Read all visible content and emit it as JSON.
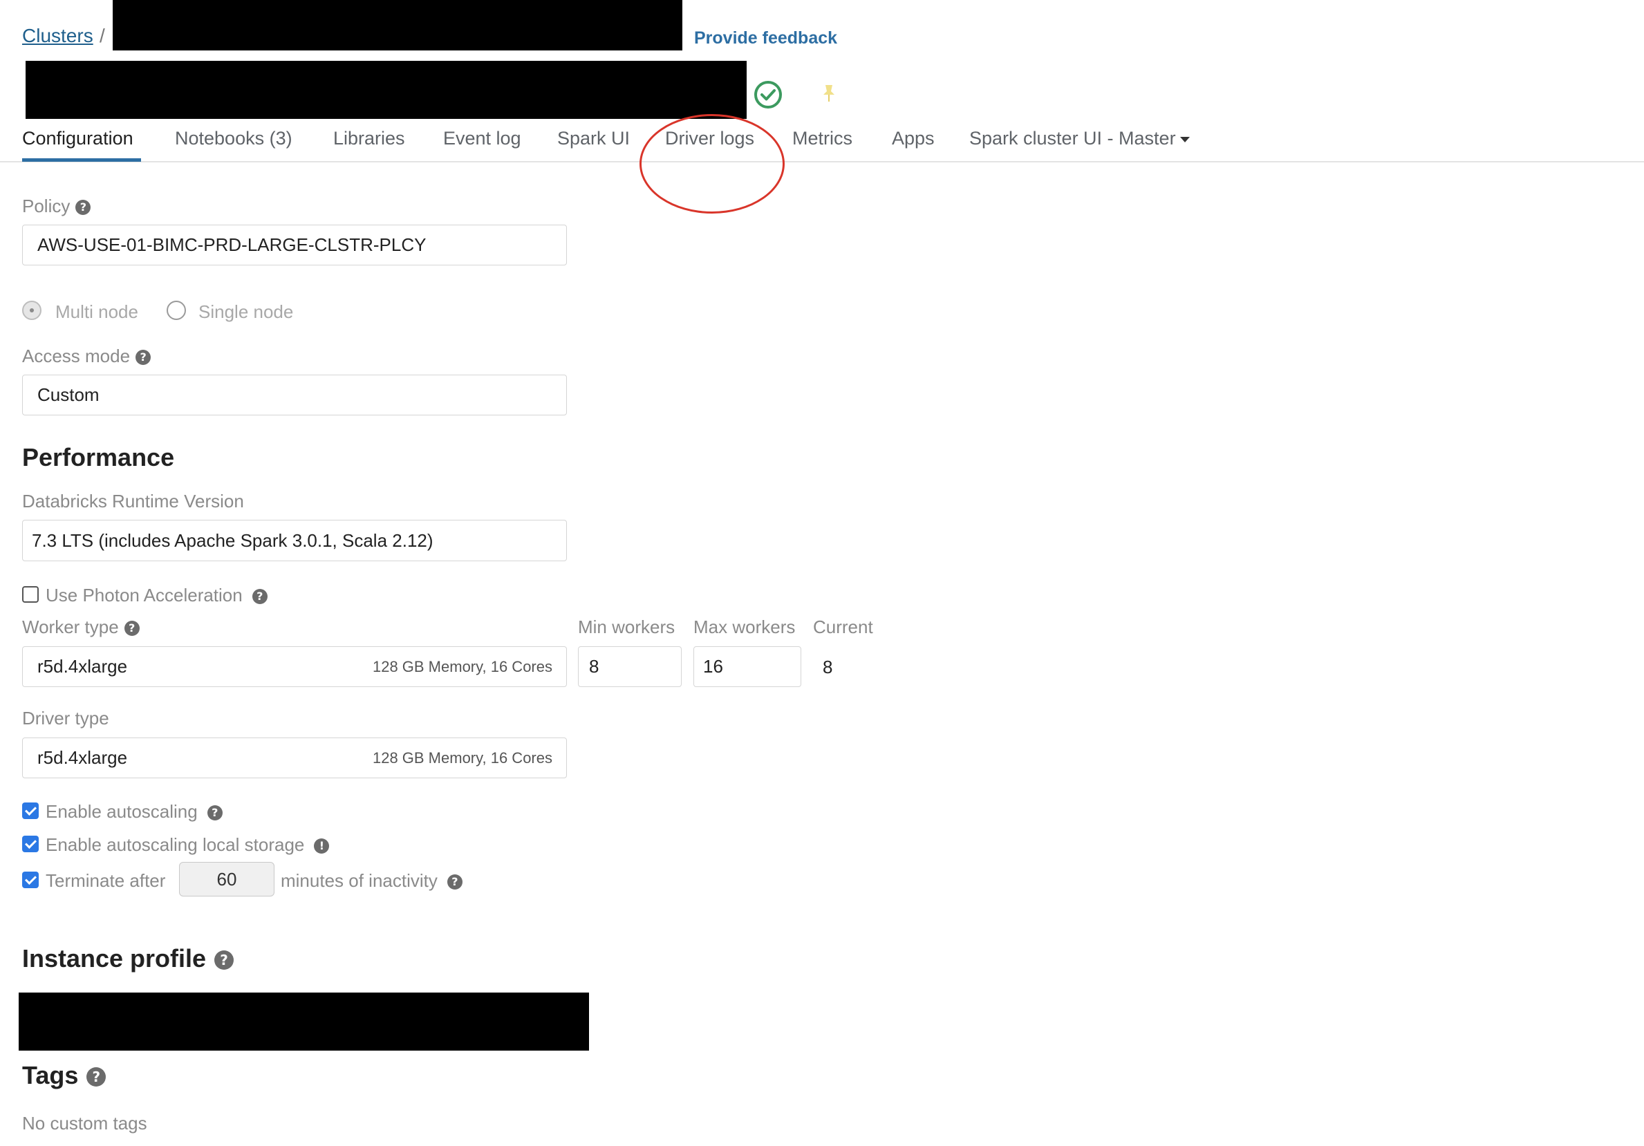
{
  "breadcrumb": {
    "link": "Clusters",
    "separator": "/"
  },
  "header": {
    "feedback": "Provide feedback",
    "status_icon": "check-circle-icon",
    "pin_icon": "pin-icon"
  },
  "tabs": [
    {
      "label": "Configuration",
      "active": true
    },
    {
      "label": "Notebooks (3)"
    },
    {
      "label": "Libraries"
    },
    {
      "label": "Event log"
    },
    {
      "label": "Spark UI"
    },
    {
      "label": "Driver logs"
    },
    {
      "label": "Metrics"
    },
    {
      "label": "Apps"
    },
    {
      "label": "Spark cluster UI - Master"
    }
  ],
  "policy": {
    "label": "Policy",
    "value": "AWS-USE-01-BIMC-PRD-LARGE-CLSTR-PLCY"
  },
  "node_mode": {
    "multi": "Multi node",
    "single": "Single node",
    "selected": "Multi node"
  },
  "access_mode": {
    "label": "Access mode",
    "value": "Custom"
  },
  "performance": {
    "title": "Performance",
    "runtime_label": "Databricks Runtime Version",
    "runtime_value": "7.3 LTS (includes Apache Spark 3.0.1, Scala 2.12)",
    "photon_label": "Use Photon Acceleration",
    "photon_checked": false,
    "worker_type_label": "Worker type",
    "worker_type_value": "r5d.4xlarge",
    "worker_type_spec": "128 GB Memory, 16 Cores",
    "min_workers_label": "Min workers",
    "min_workers_value": "8",
    "max_workers_label": "Max workers",
    "max_workers_value": "16",
    "current_label": "Current",
    "current_value": "8",
    "driver_type_label": "Driver type",
    "driver_type_value": "r5d.4xlarge",
    "driver_type_spec": "128 GB Memory, 16 Cores",
    "autoscaling_label": "Enable autoscaling",
    "autoscaling_storage_label": "Enable autoscaling local storage",
    "terminate_label": "Terminate after",
    "terminate_value": "60",
    "terminate_suffix": "minutes of inactivity"
  },
  "instance_profile": {
    "title": "Instance profile"
  },
  "tags": {
    "title": "Tags",
    "empty": "No custom tags"
  },
  "colors": {
    "accent": "#2d6ea3",
    "checkbox": "#2b78e4",
    "status_green": "#3c9a5f",
    "annotation_red": "#d9352a"
  }
}
